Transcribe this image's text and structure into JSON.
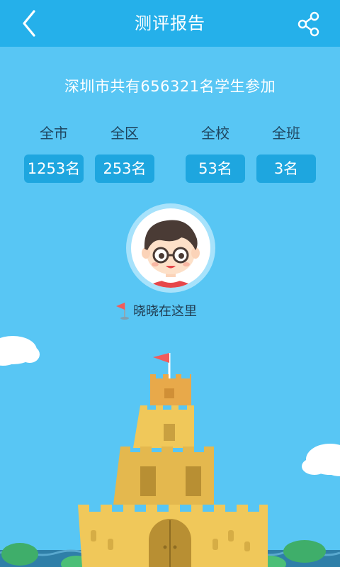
{
  "header": {
    "title": "测评报告"
  },
  "summary_text": "深圳市共有656321名学生参加",
  "ranks": [
    {
      "label": "全市",
      "value": "1253名"
    },
    {
      "label": "全区",
      "value": "253名"
    },
    {
      "label": "全校",
      "value": "53名"
    },
    {
      "label": "全班",
      "value": "3名"
    }
  ],
  "marker_text": "晓晓在这里",
  "colors": {
    "header_bg": "#25b0ea",
    "page_bg": "#58c6f4",
    "badge_bg": "#1ea6df",
    "castle": "#f0c85a",
    "flag": "#f25b5b"
  }
}
